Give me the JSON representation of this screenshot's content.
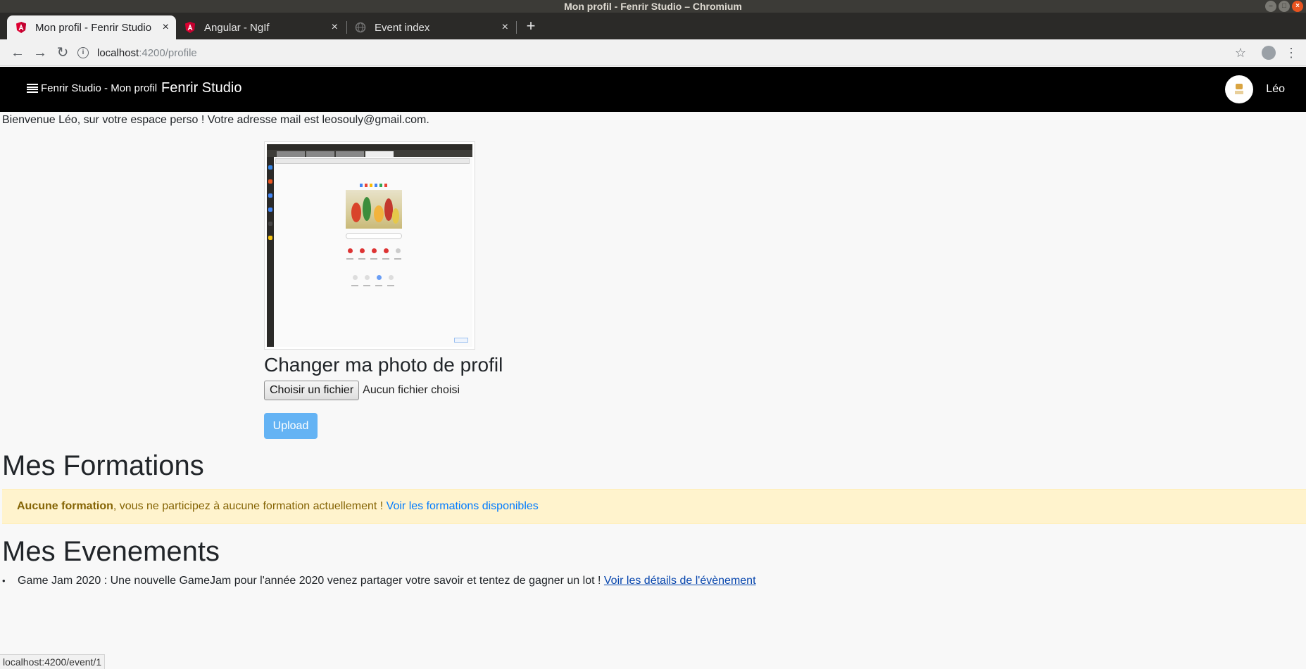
{
  "window": {
    "title": "Mon profil - Fenrir Studio – Chromium",
    "controls": [
      "–",
      "□",
      "×"
    ]
  },
  "tabs": [
    {
      "title": "Mon profil - Fenrir Studio",
      "icon": "angular-icon",
      "active": true
    },
    {
      "title": "Angular - NgIf",
      "icon": "angular-icon",
      "active": false
    },
    {
      "title": "Event index",
      "icon": "globe-icon",
      "active": false
    }
  ],
  "tab_close_glyph": "×",
  "new_tab_glyph": "+",
  "toolbar": {
    "back_glyph": "←",
    "forward_glyph": "→",
    "reload_glyph": "↻",
    "url_host": "localhost",
    "url_path": ":4200/profile",
    "star_glyph": "☆",
    "menu_glyph": "⋮"
  },
  "navbar": {
    "menu_label": "Fenrir Studio - Mon profil",
    "brand": "Fenrir Studio",
    "user_name": "Léo",
    "bg_color": "#000000"
  },
  "profile": {
    "welcome": "Bienvenue Léo, sur votre espace perso ! Votre adresse mail est leosouly@gmail.com.",
    "change_photo_title": "Changer ma photo de profil",
    "file_button": "Choisir un fichier",
    "file_status": "Aucun fichier choisi",
    "upload_button": "Upload",
    "upload_color": "#64b3f4"
  },
  "formations": {
    "title": "Mes Formations",
    "alert_strong": "Aucune formation",
    "alert_text": ", vous ne participez à aucune formation actuellement ! ",
    "alert_link": "Voir les formations disponibles",
    "alert_bg": "#fff3cd"
  },
  "events": {
    "title": "Mes Evenements",
    "items": [
      {
        "text": "Game Jam 2020 : Une nouvelle GameJam pour l'année 2020 venez partager votre savoir et tentez de gagner un lot ! ",
        "link": "Voir les détails de l'évènement"
      }
    ]
  },
  "status_bar": "localhost:4200/event/1"
}
